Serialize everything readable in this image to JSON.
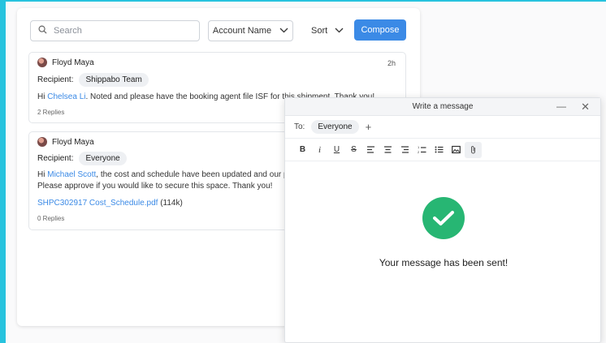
{
  "toolbar": {
    "search_placeholder": "Search",
    "account_filter": "Account Name",
    "sort_label": "Sort",
    "compose_label": "Compose"
  },
  "messages": [
    {
      "sender": "Floyd Maya",
      "time": "2h",
      "recipient_label": "Recipient:",
      "recipient": "Shippabo Team",
      "greeting": "Hi",
      "mention": "Chelsea Li",
      "text": ". Noted and please have the booking agent file ISF for this shipment. Thank you!",
      "replies": "2 Replies"
    },
    {
      "sender": "Floyd Maya",
      "recipient_label": "Recipient:",
      "recipient": "Everyone",
      "greeting": "Hi",
      "mention": "Michael Scott",
      "text_line1": ", the cost and schedule have been updated and our pr",
      "text_line2": "Please approve if you would like to secure this space. Thank you!",
      "attachment_name": "SHPC302917 Cost_Schedule.pdf",
      "attachment_size": "(114k)",
      "replies": "0 Replies"
    }
  ],
  "compose": {
    "title": "Write a message",
    "to_label": "To:",
    "to_recipient": "Everyone",
    "sent_message": "Your message has been sent!",
    "format_tools": [
      "bold",
      "italic",
      "underline",
      "strikethrough",
      "align-left",
      "align-center",
      "align-right",
      "numbered-list",
      "bulleted-list",
      "image",
      "attachment"
    ]
  },
  "colors": {
    "accent": "#3b8ae6",
    "success": "#27b673",
    "background": "#27c3de"
  }
}
